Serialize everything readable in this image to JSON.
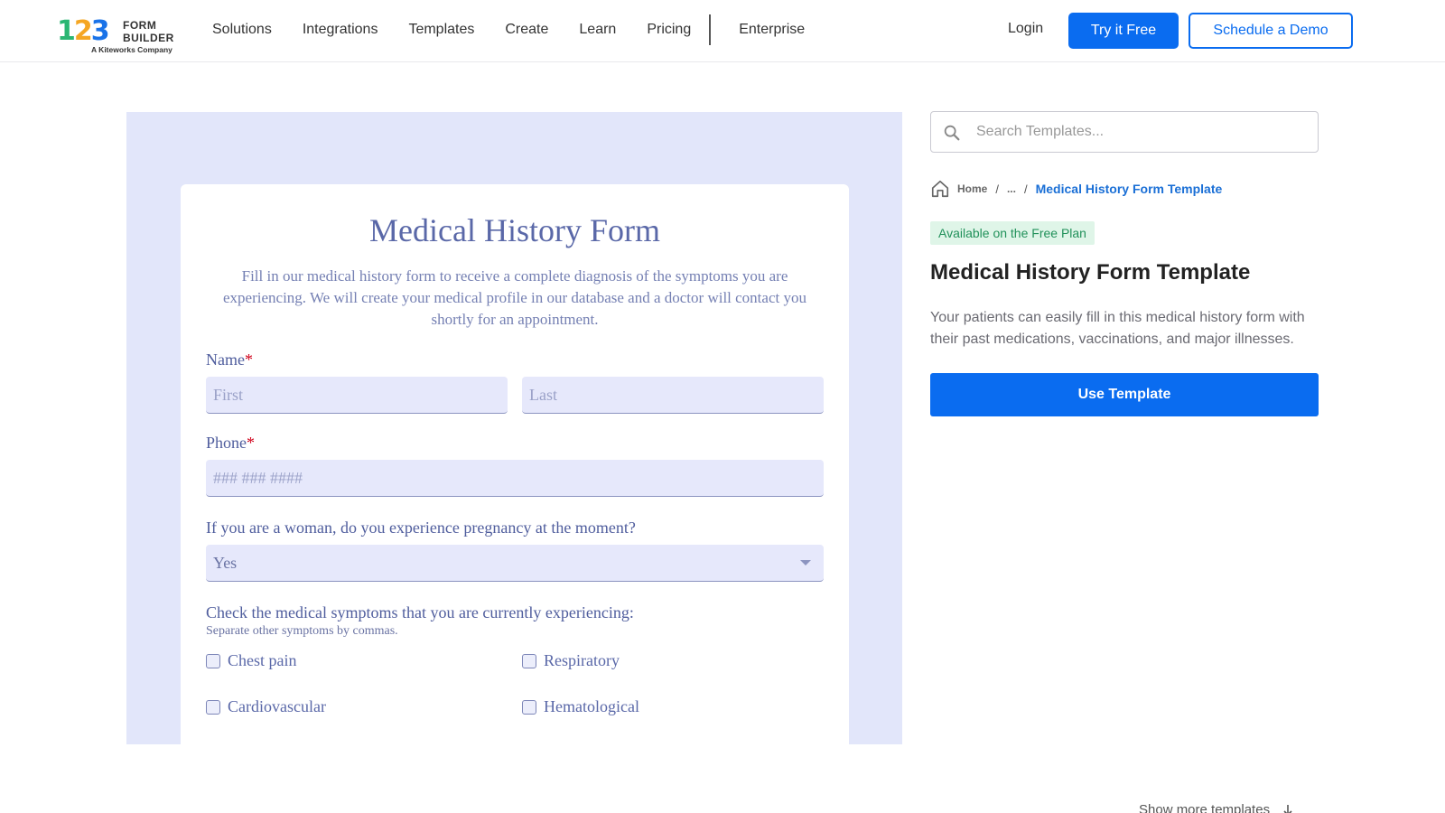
{
  "logo": {
    "digits": [
      "1",
      "2",
      "3"
    ],
    "line1": "FORM",
    "line2": "BUILDER",
    "sub": "A Kiteworks Company"
  },
  "nav": {
    "items": [
      "Solutions",
      "Integrations",
      "Templates",
      "Create",
      "Learn",
      "Pricing"
    ],
    "enterprise": "Enterprise",
    "login": "Login",
    "try_free": "Try it Free",
    "schedule_demo": "Schedule a Demo"
  },
  "form": {
    "title": "Medical History Form",
    "description": "Fill in our medical history form to receive a complete diagnosis of the symptoms you are experiencing. We will create your medical profile in our database and a doctor will contact you shortly for an appointment.",
    "name_label": "Name",
    "required_mark": "*",
    "first_placeholder": "First",
    "last_placeholder": "Last",
    "phone_label": "Phone",
    "phone_placeholder": "### ### ####",
    "pregnancy_label": "If you are a woman, do you experience pregnancy at the moment?",
    "pregnancy_value": "Yes",
    "symptoms_label": "Check the medical symptoms that you are currently experiencing:",
    "symptoms_help": "Separate other symptoms by commas.",
    "symptoms": [
      "Chest pain",
      "Respiratory",
      "Cardiovascular",
      "Hematological"
    ]
  },
  "sidebar": {
    "search_placeholder": "Search Templates...",
    "breadcrumb": {
      "home": "Home",
      "sep": "/",
      "ellipsis": "...",
      "current": "Medical History Form Template"
    },
    "badge": "Available on the Free Plan",
    "title": "Medical History Form Template",
    "description": "Your patients can easily fill in this medical history form with their past medications, vaccinations, and major illnesses.",
    "use_button": "Use Template"
  },
  "footer": {
    "show_more": "Show more templates"
  },
  "colors": {
    "accent": "#0a6cf0",
    "preview_bg": "#e2e6fa",
    "form_text": "#5a68a8",
    "badge_bg": "#dff5e8",
    "badge_text": "#21915a"
  }
}
